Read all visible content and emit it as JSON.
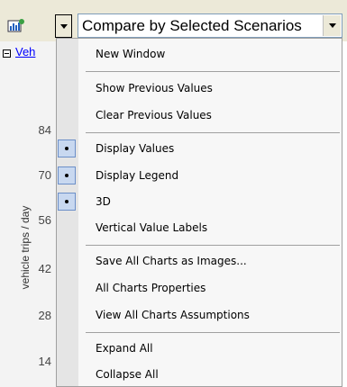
{
  "toolbar": {
    "chart_icon": "chart-settings-icon",
    "dropdown_icon": "chevron-down-icon",
    "scenario_select": {
      "value": "Compare by Selected Scenarios"
    }
  },
  "background": {
    "link_text": "Veh",
    "y_axis_label": "vehicle trips / day",
    "ticks": [
      "84",
      "70",
      "56",
      "42",
      "28",
      "14"
    ]
  },
  "menu": {
    "items": [
      {
        "label": "New Window",
        "checked": false
      },
      {
        "label": "Show Previous Values",
        "checked": false
      },
      {
        "label": "Clear Previous Values",
        "checked": false
      },
      {
        "label": "Display Values",
        "checked": true
      },
      {
        "label": "Display Legend",
        "checked": true
      },
      {
        "label": "3D",
        "checked": true
      },
      {
        "label": "Vertical Value Labels",
        "checked": false
      },
      {
        "label": "Save All Charts as Images...",
        "checked": false
      },
      {
        "label": "All Charts Properties",
        "checked": false
      },
      {
        "label": "View All Charts Assumptions",
        "checked": false
      },
      {
        "label": "Expand All",
        "checked": false
      },
      {
        "label": "Collapse All",
        "checked": false
      }
    ]
  }
}
